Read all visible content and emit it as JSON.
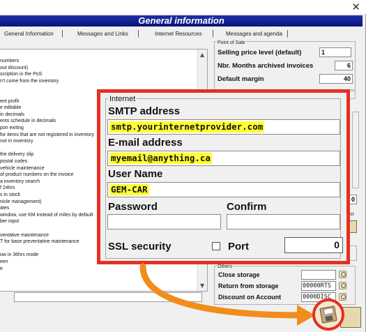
{
  "window": {
    "close_glyph": "✕"
  },
  "banner": {
    "title": "General information"
  },
  "tabs": [
    {
      "label": "General Information"
    },
    {
      "label": "Messages and Links"
    },
    {
      "label": "Internet Resources"
    },
    {
      "label": "Messages and agenda"
    }
  ],
  "options_list": [
    "numbers",
    "out discount)",
    "scription in the PoS",
    "n't come from the inventory",
    "",
    "",
    "ent profit",
    "e editable",
    "in decimals",
    "ents schedule in decimals",
    "pon exiting",
    "for items that are not registered in inventory",
    "not in inventory",
    "",
    "the delivery slip",
    "postal codes",
    "vehicle maintenance",
    "of product numbers on the invoice",
    "a inventory search",
    "f 24hrs",
    "s in stock",
    "nicle management)",
    "ates",
    "window, use KM instead of miles by default",
    "ber input",
    "",
    "ventative maintenance",
    "T for base preventative maintenance",
    "",
    "ow in 36hrs mode",
    "een",
    "e"
  ],
  "point_of_sale": {
    "group_title": "Point of Sale",
    "selling_price_label": "Selling price level (default)",
    "selling_price_value": "1",
    "months_archived_label": "Nbr. Months archived invoices",
    "months_archived_value": "6",
    "default_margin_label": "Default margin",
    "default_margin_value": "40"
  },
  "side_edge": {
    "value_right": "0",
    "partial_label": "st"
  },
  "others": {
    "group_title": "Others",
    "close_storage_label": "Close storage",
    "close_storage_value": "",
    "return_storage_label": "Return from storage",
    "return_storage_value": "00000RTS",
    "discount_label": "Discount on Account",
    "discount_value": "0000DISC"
  },
  "internet": {
    "legend": "Internet",
    "smtp_label": "SMTP address",
    "smtp_value": "smtp.yourinternetprovider.com",
    "email_label": "E-mail address",
    "email_value": "myemail@anything.ca",
    "username_label": "User Name",
    "username_value": "GEM-CAR",
    "password_label": "Password",
    "confirm_label": "Confirm",
    "ssl_label": "SSL security",
    "port_label": "Port",
    "port_value": "0"
  },
  "colors": {
    "highlight_red": "#e53023",
    "highlight_yellow": "#ffff33",
    "arrow_orange": "#f28c1c",
    "banner_blue": "#0a1478"
  },
  "icons": [
    "close-icon",
    "save-icon",
    "lookup-icon",
    "scroll-up-icon",
    "scroll-down-icon"
  ]
}
